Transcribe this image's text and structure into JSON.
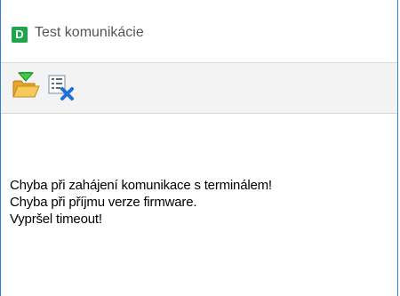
{
  "window": {
    "title": "Test komunikácie",
    "app_icon_letter": "D"
  },
  "toolbar": {
    "buttons": [
      {
        "name": "open-folder",
        "icon": "folder-open-green-arrow-icon"
      },
      {
        "name": "clear-log",
        "icon": "list-delete-icon"
      }
    ]
  },
  "log": {
    "lines": [
      "Chyba při zahájení komunikace s terminálem!",
      "Chyba při příjmu verze firmware.",
      "Vypršel timeout!"
    ]
  },
  "colors": {
    "window_border": "#2f7fd6",
    "app_icon_bg": "#1fa54a",
    "toolbar_bg": "#f3f3f3"
  }
}
